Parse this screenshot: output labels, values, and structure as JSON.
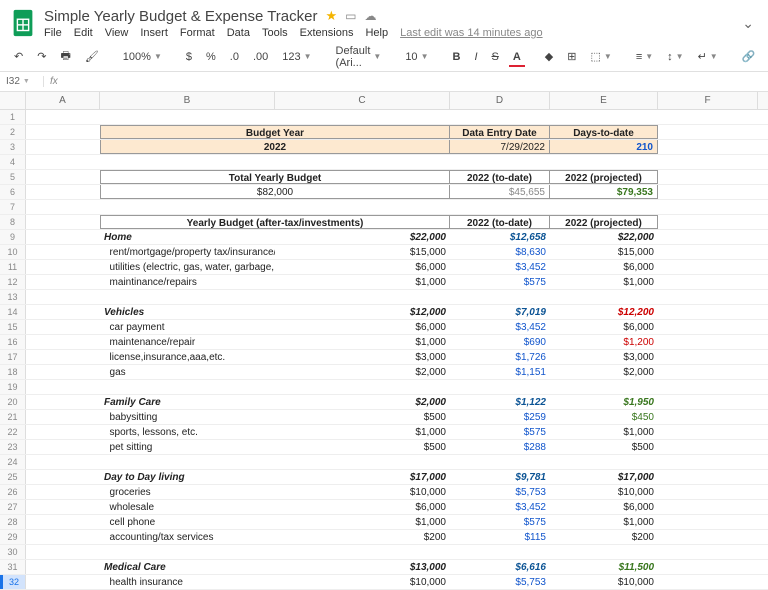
{
  "doc_title": "Simple Yearly Budget & Expense Tracker",
  "last_edit": "Last edit was 14 minutes ago",
  "menu": [
    "File",
    "Edit",
    "View",
    "Insert",
    "Format",
    "Data",
    "Tools",
    "Extensions",
    "Help"
  ],
  "toolbar": {
    "zoom": "100%",
    "font": "Default (Ari...",
    "size": "10",
    "format123": "123"
  },
  "namebox": "I32",
  "cols": [
    "A",
    "B",
    "C",
    "D",
    "E",
    "F"
  ],
  "header_row1": {
    "budget_year": "Budget Year",
    "entry_date": "Data Entry Date",
    "days": "Days-to-date"
  },
  "header_row2": {
    "budget_year": "2022",
    "entry_date": "7/29/2022",
    "days": "210"
  },
  "totals_row1": {
    "label": "Total Yearly Budget",
    "td": "2022 (to-date)",
    "proj": "2022 (projected)"
  },
  "totals_row2": {
    "label": "$82,000",
    "td": "$45,655",
    "proj": "$79,353"
  },
  "section_hdr": {
    "label": "Yearly Budget (after-tax/investments)",
    "td": "2022 (to-date)",
    "proj": "2022 (projected)"
  },
  "rows": [
    {
      "b": "Home",
      "c": "$22,000",
      "d": "$12,658",
      "e": "$22,000",
      "style": "cat"
    },
    {
      "b": "rent/mortgage/property tax/insurance/hoa fees",
      "c": "$15,000",
      "d": "$8,630",
      "e": "$15,000",
      "style": "sub"
    },
    {
      "b": "utilities (electric, gas, water, garbage, internet, etc.)",
      "c": "$6,000",
      "d": "$3,452",
      "e": "$6,000",
      "style": "sub"
    },
    {
      "b": "maintinance/repairs",
      "c": "$1,000",
      "d": "$575",
      "e": "$1,000",
      "style": "sub"
    },
    {
      "blank": true
    },
    {
      "b": "Vehicles",
      "c": "$12,000",
      "d": "$7,019",
      "e": "$12,200",
      "style": "cat",
      "ered": true
    },
    {
      "b": "car payment",
      "c": "$6,000",
      "d": "$3,452",
      "e": "$6,000",
      "style": "sub"
    },
    {
      "b": "maintenance/repair",
      "c": "$1,000",
      "d": "$690",
      "e": "$1,200",
      "style": "sub",
      "ered": true
    },
    {
      "b": "license,insurance,aaa,etc.",
      "c": "$3,000",
      "d": "$1,726",
      "e": "$3,000",
      "style": "sub"
    },
    {
      "b": "gas",
      "c": "$2,000",
      "d": "$1,151",
      "e": "$2,000",
      "style": "sub"
    },
    {
      "blank": true
    },
    {
      "b": "Family Care",
      "c": "$2,000",
      "d": "$1,122",
      "e": "$1,950",
      "style": "cat",
      "egreen": true
    },
    {
      "b": "babysitting",
      "c": "$500",
      "d": "$259",
      "e": "$450",
      "style": "sub",
      "egreen": true
    },
    {
      "b": "sports, lessons, etc.",
      "c": "$1,000",
      "d": "$575",
      "e": "$1,000",
      "style": "sub"
    },
    {
      "b": "pet sitting",
      "c": "$500",
      "d": "$288",
      "e": "$500",
      "style": "sub"
    },
    {
      "blank": true
    },
    {
      "b": "Day to Day living",
      "c": "$17,000",
      "d": "$9,781",
      "e": "$17,000",
      "style": "cat"
    },
    {
      "b": "groceries",
      "c": "$10,000",
      "d": "$5,753",
      "e": "$10,000",
      "style": "sub"
    },
    {
      "b": "wholesale",
      "c": "$6,000",
      "d": "$3,452",
      "e": "$6,000",
      "style": "sub"
    },
    {
      "b": "cell phone",
      "c": "$1,000",
      "d": "$575",
      "e": "$1,000",
      "style": "sub"
    },
    {
      "b": "accounting/tax services",
      "c": "$200",
      "d": "$115",
      "e": "$200",
      "style": "sub"
    },
    {
      "blank": true
    },
    {
      "b": "Medical Care",
      "c": "$13,000",
      "d": "$6,616",
      "e": "$11,500",
      "style": "cat",
      "egreen": true
    },
    {
      "b": "health insurance",
      "c": "$10,000",
      "d": "$5,753",
      "e": "$10,000",
      "style": "sub"
    }
  ]
}
